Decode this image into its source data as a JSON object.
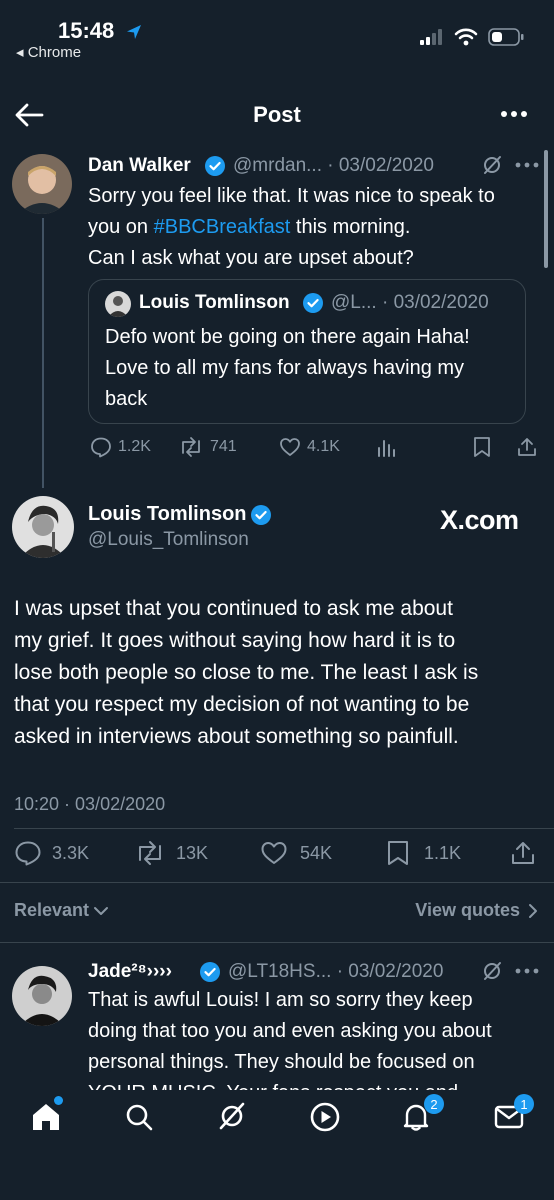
{
  "status_bar": {
    "time": "15:48",
    "back_app": "◂ Chrome"
  },
  "header": {
    "title": "Post"
  },
  "reply_tweet": {
    "name": "Dan Walker",
    "handle_date": "@mrdan... · 03/02/2020",
    "text_line1": "Sorry you feel like that. It was nice to speak to",
    "text_line2_pre": "you on ",
    "hashtag": "#BBCBreakfast",
    "text_line2_post": " this morning.",
    "text_line3": "Can I ask what you are upset about?",
    "replies": "1.2K",
    "reposts": "741",
    "likes": "4.1K"
  },
  "quoted_tweet": {
    "name": "Louis Tomlinson",
    "handle_date": "@L... · 03/02/2020",
    "line1": "Defo wont be going on there again Haha!",
    "line2": "Love to all my fans for always having my",
    "line3": "back"
  },
  "main_tweet": {
    "name": "Louis Tomlinson",
    "handle": "@Louis_Tomlinson",
    "watermark": "X.com",
    "line1": "I was upset that you continued to ask me about",
    "line2": "my grief. It goes without saying how hard it is to",
    "line3": "lose both people so close to me. The least I ask is",
    "line4": "that you respect my decision of not wanting to be",
    "line5": "asked in interviews about something so painfull.",
    "timestamp": "10:20 · 03/02/2020",
    "replies": "3.3K",
    "reposts": "13K",
    "likes": "54K",
    "bookmarks": "1.1K"
  },
  "sort": {
    "relevant": "Relevant",
    "view_quotes": "View quotes"
  },
  "reply2": {
    "name": "Jade²⁸››››",
    "handle_date": "@LT18HS... · 03/02/2020",
    "line1": "That is awful Louis! I am so sorry they keep",
    "line2": "doing that too you and even asking you about",
    "line3": "personal things. They should be focused on",
    "line4": "YOUR MUSIC. Your fans respect you and"
  },
  "tabbar": {
    "notifications_badge": "2",
    "messages_badge": "1"
  },
  "colors": {
    "background": "#15202b",
    "accent": "#1d9bf0",
    "muted": "#8b98a5",
    "border": "#38444d"
  }
}
